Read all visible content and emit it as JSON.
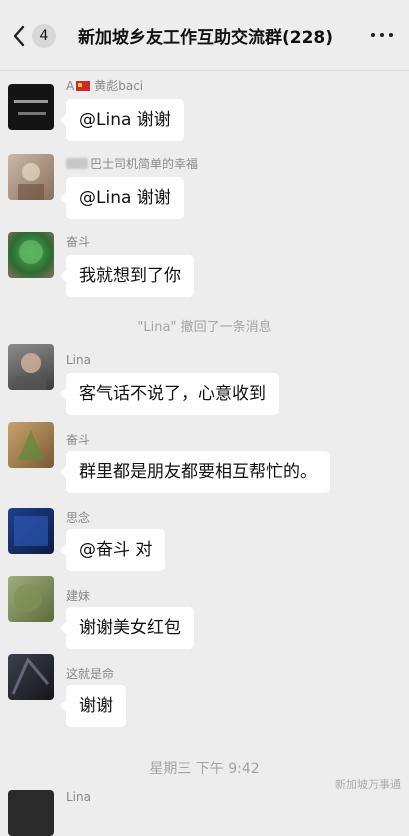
{
  "header": {
    "back_count": "4",
    "title": "新加坡乡友工作互助交流群(228)"
  },
  "messages": [
    {
      "sender": "A",
      "sender_name_tail": "黄彪baci",
      "text": "@Lina 谢谢"
    },
    {
      "sender": "巴士司机简单的幸福",
      "text": "@Lina 谢谢"
    },
    {
      "sender": "奋斗",
      "text": "我就想到了你"
    },
    {
      "sender": "Lina",
      "text": "客气话不说了，心意收到"
    },
    {
      "sender": "奋斗",
      "text": "群里都是朋友都要相互帮忙的。"
    },
    {
      "sender": "思念",
      "text": "@奋斗 对"
    },
    {
      "sender": "建妹",
      "text": "谢谢美女红包"
    },
    {
      "sender": "这就是命",
      "text": "谢谢"
    },
    {
      "sender": "Lina"
    }
  ],
  "system_notices": {
    "recall": "\"Lina\" 撤回了一条消息",
    "timestamp": "星期三 下午 9:42"
  },
  "watermark": "新加坡万事通",
  "colors": {
    "page_bg": "#ededed",
    "bubble_bg": "#ffffff",
    "system_text": "#a3a3a3",
    "sender_text": "#888888"
  }
}
